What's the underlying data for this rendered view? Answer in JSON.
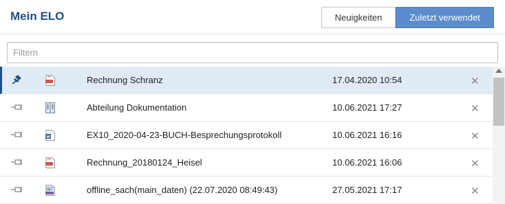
{
  "header": {
    "title": "Mein ELO",
    "tabs": [
      {
        "label": "Neuigkeiten",
        "active": false
      },
      {
        "label": "Zuletzt verwendet",
        "active": true
      }
    ]
  },
  "filter": {
    "placeholder": "Filtern",
    "value": ""
  },
  "items": [
    {
      "name": "Rechnung Schranz",
      "date": "17.04.2020 10:54",
      "file_type": "pdf",
      "pinned": true,
      "selected": true
    },
    {
      "name": "Abteilung Dokumentation",
      "date": "10.06.2021 17:27",
      "file_type": "folder",
      "pinned": false,
      "selected": false
    },
    {
      "name": "EX10_2020-04-23-BUCH-Besprechungsprotokoll",
      "date": "10.06.2021 16:16",
      "file_type": "word",
      "pinned": false,
      "selected": false
    },
    {
      "name": "Rechnung_20180124_Heisel",
      "date": "10.06.2021 16:06",
      "file_type": "pdf",
      "pinned": false,
      "selected": false
    },
    {
      "name": "offline_sach(main_daten) (22.07.2020 08:49:43)",
      "date": "27.05.2021 17:17",
      "file_type": "jpg",
      "pinned": false,
      "selected": false
    }
  ],
  "close_glyph": "✕",
  "colors": {
    "accent": "#1f4f86",
    "button_active": "#5b8dcc",
    "row_selected": "#e1ebf5",
    "pdf": "#d9534f",
    "word": "#2b5797",
    "folder": "#6f8aa8",
    "jpg": "#7b5ea8"
  }
}
